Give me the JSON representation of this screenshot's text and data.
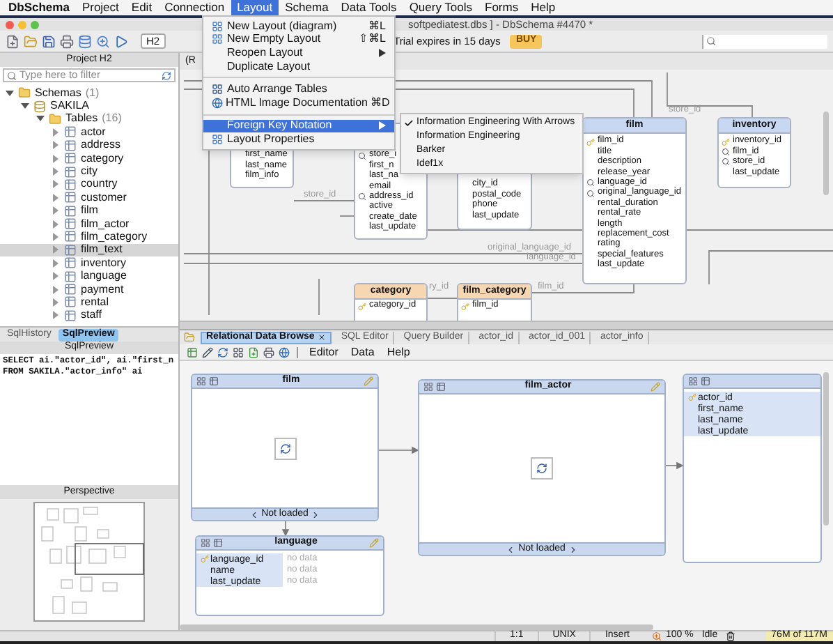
{
  "menu_bar": [
    {
      "label": "DbSchema",
      "selected": false
    },
    {
      "label": "Project",
      "selected": false
    },
    {
      "label": "Edit",
      "selected": false
    },
    {
      "label": "Connection",
      "selected": false
    },
    {
      "label": "Layout",
      "selected": true
    },
    {
      "label": "Schema",
      "selected": false
    },
    {
      "label": "Data Tools",
      "selected": false
    },
    {
      "label": "Query Tools",
      "selected": false
    },
    {
      "label": "Forms",
      "selected": false
    },
    {
      "label": "Help",
      "selected": false
    }
  ],
  "window": {
    "title": "softpediatest.dbs ] - DbSchema #4470 *"
  },
  "toolbar": {
    "schema_select": "H2",
    "trial_notice": "Trial expires in 15 days",
    "buy_button": "BUY"
  },
  "layout_menu": [
    {
      "kind": "item",
      "label": "New Layout (diagram)",
      "shortcut": "⌘L",
      "selected": false
    },
    {
      "kind": "item",
      "label": "New Empty Layout",
      "shortcut": "⇧⌘L",
      "selected": false
    },
    {
      "kind": "item",
      "label": "Reopen Layout",
      "submenu": true,
      "selected": false
    },
    {
      "kind": "item",
      "label": "Duplicate Layout",
      "submenu": false,
      "selected": false
    },
    {
      "kind": "separator"
    },
    {
      "kind": "item",
      "label": "Auto Arrange Tables",
      "submenu": false,
      "selected": false
    },
    {
      "kind": "item",
      "label": "HTML Image Documentation",
      "shortcut": "⌘D",
      "selected": false
    },
    {
      "kind": "separator"
    },
    {
      "kind": "item",
      "label": "Foreign Key Notation",
      "submenu": true,
      "selected": true
    },
    {
      "kind": "item",
      "label": "Layout Properties",
      "submenu": false,
      "selected": false
    }
  ],
  "notation_submenu": [
    {
      "label": "Information Engineering With Arrows",
      "checked": true
    },
    {
      "label": "Information Engineering",
      "checked": false
    },
    {
      "label": "Barker",
      "checked": false
    },
    {
      "label": "Idef1x",
      "checked": false
    }
  ],
  "project_panel": {
    "title": "Project H2",
    "filter": {
      "placeholder": "Type here to filter"
    },
    "tree": [
      {
        "label": "Schemas",
        "count": "(1)",
        "kind": "folder",
        "expanded": true,
        "selected": false,
        "children": [
          {
            "label": "SAKILA",
            "kind": "schema",
            "expanded": true,
            "selected": false,
            "children": [
              {
                "label": "Tables",
                "count": "(16)",
                "kind": "folder",
                "expanded": true,
                "selected": false,
                "children": [
                  {
                    "label": "actor",
                    "kind": "table",
                    "expanded": false,
                    "selected": false
                  },
                  {
                    "label": "address",
                    "kind": "table",
                    "expanded": false,
                    "selected": false
                  },
                  {
                    "label": "category",
                    "kind": "table",
                    "expanded": false,
                    "selected": false
                  },
                  {
                    "label": "city",
                    "kind": "table",
                    "expanded": false,
                    "selected": false
                  },
                  {
                    "label": "country",
                    "kind": "table",
                    "expanded": false,
                    "selected": false
                  },
                  {
                    "label": "customer",
                    "kind": "table",
                    "expanded": false,
                    "selected": false
                  },
                  {
                    "label": "film",
                    "kind": "table",
                    "expanded": false,
                    "selected": false
                  },
                  {
                    "label": "film_actor",
                    "kind": "table",
                    "expanded": false,
                    "selected": false
                  },
                  {
                    "label": "film_category",
                    "kind": "table",
                    "expanded": false,
                    "selected": false
                  },
                  {
                    "label": "film_text",
                    "kind": "table",
                    "expanded": false,
                    "selected": true
                  },
                  {
                    "label": "inventory",
                    "kind": "table",
                    "expanded": false,
                    "selected": false
                  },
                  {
                    "label": "language",
                    "kind": "table",
                    "expanded": false,
                    "selected": false
                  },
                  {
                    "label": "payment",
                    "kind": "table",
                    "expanded": false,
                    "selected": false
                  },
                  {
                    "label": "rental",
                    "kind": "table",
                    "expanded": false,
                    "selected": false
                  },
                  {
                    "label": "staff",
                    "kind": "table",
                    "expanded": false,
                    "selected": false
                  }
                ]
              }
            ]
          }
        ]
      }
    ]
  },
  "sql_tabs": [
    {
      "label": "SqlHistory",
      "selected": false
    },
    {
      "label": "SqlPreview",
      "selected": true
    }
  ],
  "sql_preview": {
    "title": "SqlPreview",
    "lines": [
      "SELECT ai.\"actor_id\", ai.\"first_n",
      "FROM SAKILA.\"actor_info\" ai"
    ]
  },
  "perspective": {
    "title": "Perspective"
  },
  "diagram": {
    "tab": "(R",
    "tables": [
      {
        "rows": [
          {
            "name": "first_name",
            "kind": "plain"
          },
          {
            "name": "last_name",
            "kind": "plain"
          },
          {
            "name": "film_info",
            "kind": "plain"
          }
        ]
      },
      {
        "rows": [
          {
            "name": "store_i",
            "kind": "fk"
          },
          {
            "name": "first_n",
            "kind": "plain"
          },
          {
            "name": "last_na",
            "kind": "plain"
          },
          {
            "name": "email",
            "kind": "plain"
          },
          {
            "name": "address_id",
            "kind": "fk"
          },
          {
            "name": "active",
            "kind": "plain"
          },
          {
            "name": "create_date",
            "kind": "plain"
          },
          {
            "name": "last_update",
            "kind": "plain"
          }
        ]
      },
      {
        "rows": [
          {
            "name": "city_id",
            "kind": "plain"
          },
          {
            "name": "postal_code",
            "kind": "plain"
          },
          {
            "name": "phone",
            "kind": "plain"
          },
          {
            "name": "last_update",
            "kind": "plain"
          }
        ]
      },
      {
        "name": "film",
        "color": "#c8d8f2",
        "rows": [
          {
            "name": "film_id",
            "kind": "pk"
          },
          {
            "name": "title",
            "kind": "plain"
          },
          {
            "name": "description",
            "kind": "plain"
          },
          {
            "name": "release_year",
            "kind": "plain"
          },
          {
            "name": "language_id",
            "kind": "fk"
          },
          {
            "name": "original_language_id",
            "kind": "fk"
          },
          {
            "name": "rental_duration",
            "kind": "plain"
          },
          {
            "name": "rental_rate",
            "kind": "plain"
          },
          {
            "name": "length",
            "kind": "plain"
          },
          {
            "name": "replacement_cost",
            "kind": "plain"
          },
          {
            "name": "rating",
            "kind": "plain"
          },
          {
            "name": "special_features",
            "kind": "plain"
          },
          {
            "name": "last_update",
            "kind": "plain"
          }
        ]
      },
      {
        "name": "inventory",
        "color": "#c8d8f2",
        "rows": [
          {
            "name": "inventory_id",
            "kind": "pk"
          },
          {
            "name": "film_id",
            "kind": "fk"
          },
          {
            "name": "store_id",
            "kind": "fk"
          },
          {
            "name": "last_update",
            "kind": "plain"
          }
        ]
      },
      {
        "name": "category",
        "color": "#f7d6b2",
        "rows": [
          {
            "name": "category_id",
            "kind": "pk"
          }
        ]
      },
      {
        "name": "film_category",
        "color": "#f7d6b2",
        "rows": [
          {
            "name": "film_id",
            "kind": "pk"
          }
        ]
      }
    ],
    "labels": [
      "store_id",
      "original_language_id",
      "language_id",
      "ry_id",
      "film_id",
      "store_id"
    ]
  },
  "browser": {
    "tabs": [
      {
        "label": "Relational Data Browse",
        "selected": true
      },
      {
        "label": "SQL Editor",
        "selected": false
      },
      {
        "label": "Query Builder",
        "selected": false
      },
      {
        "label": "actor_id",
        "selected": false
      },
      {
        "label": "actor_id_001",
        "selected": false
      },
      {
        "label": "actor_info",
        "selected": false
      }
    ],
    "menu": [
      "Editor",
      "Data",
      "Help"
    ],
    "boxes": [
      {
        "kind": "loader",
        "title": "film",
        "footer": "Not loaded"
      },
      {
        "kind": "grid",
        "title": "language",
        "rows": [
          {
            "column": "language_id",
            "kind": "pk",
            "value": "no data"
          },
          {
            "column": "name",
            "kind": "plain",
            "value": "no data"
          },
          {
            "column": "last_update",
            "kind": "plain",
            "value": "no data"
          }
        ]
      },
      {
        "kind": "loader",
        "title": "film_actor",
        "footer": "Not loaded"
      },
      {
        "kind": "list",
        "rows": [
          {
            "column": "actor_id",
            "kind": "pk"
          },
          {
            "column": "first_name",
            "kind": "plain"
          },
          {
            "column": "last_name",
            "kind": "plain"
          },
          {
            "column": "last_update",
            "kind": "plain"
          }
        ]
      }
    ]
  },
  "status_bar": [
    "1:1",
    "UNIX",
    "Insert",
    "100 %",
    "Idle",
    "76M of 117M"
  ]
}
